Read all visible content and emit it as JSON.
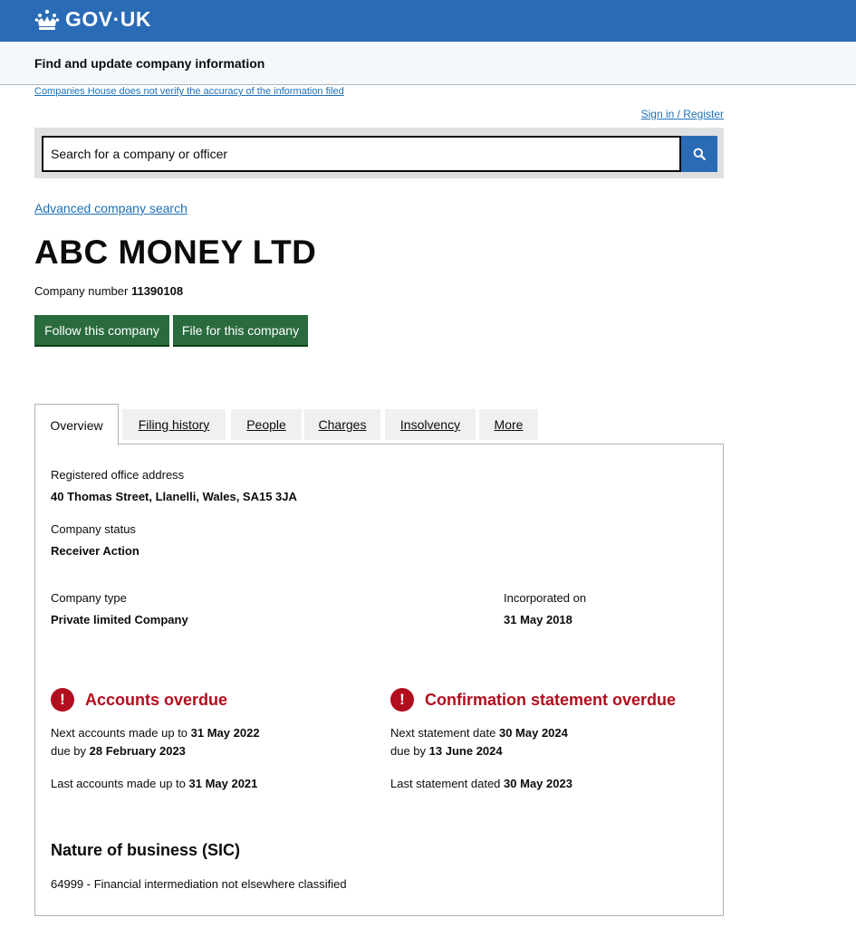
{
  "header": {
    "logo_text": "GOV·UK",
    "service_name": "Find and update company information"
  },
  "disclaimer": "Companies House does not verify the accuracy of the information filed",
  "sign_in": "Sign in / Register",
  "search": {
    "placeholder": "Search for a company or officer",
    "value": ""
  },
  "advanced_search": "Advanced company search",
  "company": {
    "name": "ABC MONEY LTD",
    "number_label": "Company number",
    "number": "11390108"
  },
  "buttons": {
    "follow": "Follow this company",
    "file": "File for this company"
  },
  "tabs": [
    {
      "label": "Overview",
      "active": true
    },
    {
      "label": "Filing history",
      "active": false
    },
    {
      "label": "People",
      "active": false
    },
    {
      "label": "Charges",
      "active": false
    },
    {
      "label": "Insolvency",
      "active": false
    },
    {
      "label": "More",
      "active": false
    }
  ],
  "overview": {
    "registered_office_label": "Registered office address",
    "registered_office": "40 Thomas Street, Llanelli, Wales, SA15 3JA",
    "status_label": "Company status",
    "status": "Receiver Action",
    "type_label": "Company type",
    "type": "Private limited Company",
    "incorporated_label": "Incorporated on",
    "incorporated": "31 May 2018"
  },
  "accounts": {
    "icon": "!",
    "title": "Accounts overdue",
    "next_label": "Next accounts made up to",
    "next_date": "31 May 2022",
    "due_label": "due by",
    "due_date": "28 February 2023",
    "last_label": "Last accounts made up to",
    "last_date": "31 May 2021"
  },
  "confirmation": {
    "icon": "!",
    "title": "Confirmation statement overdue",
    "next_label": "Next statement date",
    "next_date": "30 May 2024",
    "due_label": "due by",
    "due_date": "13 June 2024",
    "last_label": "Last statement dated",
    "last_date": "30 May 2023"
  },
  "sic": {
    "title": "Nature of business (SIC)",
    "line": "64999 - Financial intermediation not elsewhere classified"
  },
  "colors": {
    "header_blue": "#2a6bb6",
    "link_blue": "#1d70b8",
    "button_green": "#2a6b3e",
    "alert_red": "#b10e1e"
  },
  "icons": {
    "logo": "crown-icon",
    "search": "search-icon",
    "alert": "exclamation-circle-icon"
  }
}
